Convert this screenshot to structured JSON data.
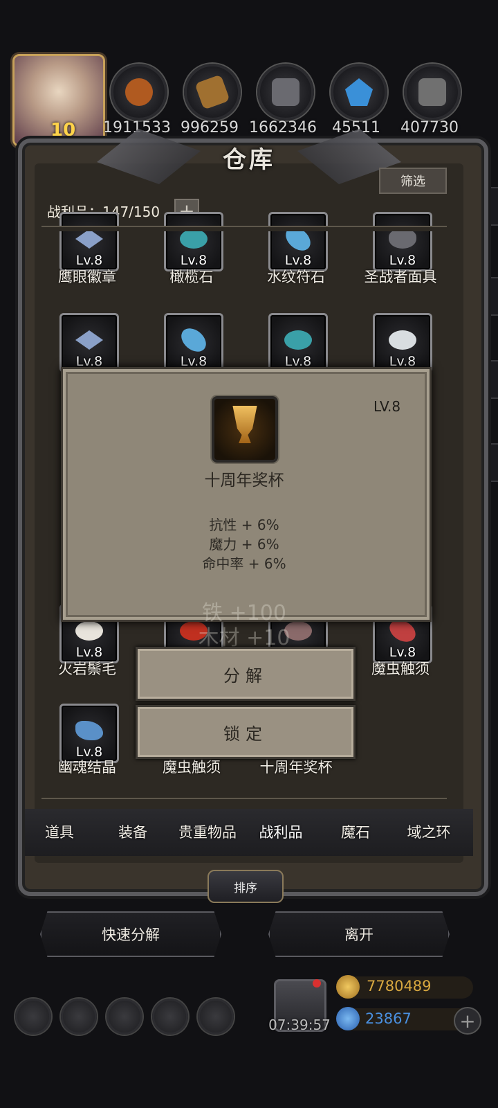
{
  "header": {
    "avatar_level": "10",
    "resources": [
      {
        "icon": "meat-icon",
        "value": "1911533",
        "color": "#b05a20"
      },
      {
        "icon": "wood-icon",
        "value": "996259",
        "color": "#a07030"
      },
      {
        "icon": "iron-icon",
        "value": "1662346",
        "color": "#6a6a70"
      },
      {
        "icon": "crystal-icon",
        "value": "45511",
        "color": "#3a90d8"
      },
      {
        "icon": "stone-icon",
        "value": "407730",
        "color": "#707070"
      }
    ]
  },
  "panel": {
    "title": "仓库",
    "filter_label": "筛选",
    "loot_count": "战利品：147/150",
    "plus_label": "+"
  },
  "items": {
    "row1": [
      {
        "name": "鹰眼徽章",
        "level": "Lv.8",
        "color": "#8aa0c8"
      },
      {
        "name": "橄榄石",
        "level": "Lv.8",
        "color": "#3aa0a8"
      },
      {
        "name": "水纹符石",
        "level": "Lv.8",
        "color": "#5aa8d8"
      },
      {
        "name": "圣战者面具",
        "level": "Lv.8",
        "color": "#6a6a70"
      }
    ],
    "row2": [
      {
        "level": "Lv.8",
        "color": "#8aa0c8"
      },
      {
        "level": "Lv.8",
        "color": "#5aa8d8"
      },
      {
        "level": "Lv.8",
        "color": "#3aa0a8"
      },
      {
        "level": "Lv.8",
        "color": "#d8dde0"
      }
    ],
    "row3": [
      {
        "name": "火岩鬃毛",
        "level": "Lv.8",
        "color": "#e8e4dc"
      },
      {
        "name": "魔虫触须",
        "level": "Lv.8",
        "color": "#c04040"
      }
    ],
    "row4": [
      {
        "name": "幽魂结晶",
        "level": "Lv.8",
        "color": "#5a90c8"
      },
      {
        "name": "魔虫触须"
      },
      {
        "name": "十周年奖杯"
      }
    ]
  },
  "popup": {
    "level": "LV.8",
    "name": "十周年奖杯",
    "stats": [
      "抗性 + 6%",
      "魔力 + 6%",
      "命中率 + 6%"
    ],
    "ghost_lines": [
      "铁 +100",
      "木材 +10"
    ],
    "decompose_label": "分解",
    "lock_label": "锁定"
  },
  "tabs": [
    "道具",
    "装备",
    "贵重物品",
    "战利品",
    "魔石",
    "域之环"
  ],
  "active_tab": "战利品",
  "sort_label": "排序",
  "actions": {
    "quick_decompose": "快速分解",
    "leave": "离开"
  },
  "hud": {
    "timer": "07:39:57",
    "gold": "7780489",
    "gems": "23867",
    "gold_color": "#d8a840",
    "gem_color": "#4a90e0"
  }
}
